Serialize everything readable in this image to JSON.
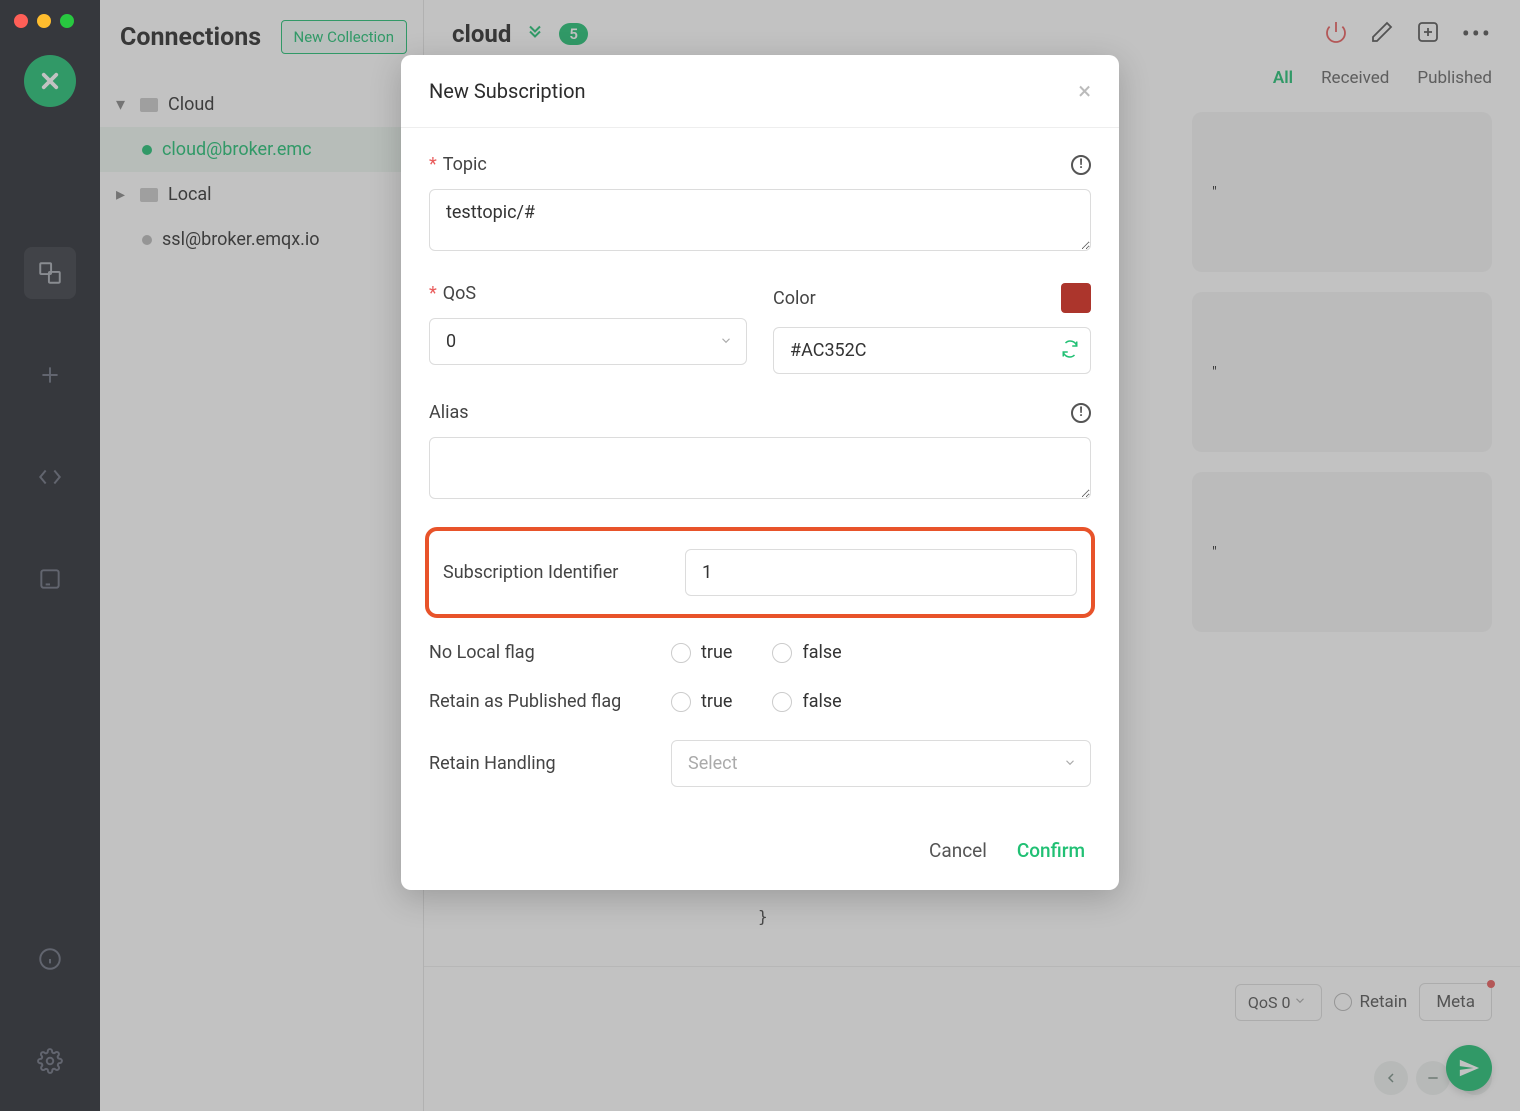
{
  "sidebar": {
    "title": "Connections",
    "new_collection_label": "New Collection",
    "tree": {
      "group1": {
        "label": "Cloud"
      },
      "item1": {
        "label": "cloud@broker.emc"
      },
      "group2": {
        "label": "Local"
      },
      "item2": {
        "label": "ssl@broker.emqx.io"
      }
    }
  },
  "header": {
    "title": "cloud",
    "badge": "5",
    "tabs": {
      "all": "All",
      "received": "Received",
      "published": "Published"
    }
  },
  "messages": {
    "card1": "\"",
    "card2": "\"",
    "card3": "\"",
    "json_close": "}"
  },
  "composer": {
    "qos_prefix": "QoS",
    "qos_value": "0",
    "retain_label": "Retain",
    "meta_label": "Meta"
  },
  "modal": {
    "title": "New Subscription",
    "topic": {
      "label": "Topic",
      "value": "testtopic/#"
    },
    "qos": {
      "label": "QoS",
      "value": "0"
    },
    "color": {
      "label": "Color",
      "value": "#AC352C",
      "swatch": "#AC352C"
    },
    "alias": {
      "label": "Alias",
      "value": ""
    },
    "sub_id": {
      "label": "Subscription Identifier",
      "value": "1"
    },
    "no_local": {
      "label": "No Local flag",
      "opt_true": "true",
      "opt_false": "false"
    },
    "retain_pub": {
      "label": "Retain as Published flag",
      "opt_true": "true",
      "opt_false": "false"
    },
    "retain_handling": {
      "label": "Retain Handling",
      "placeholder": "Select"
    },
    "cancel": "Cancel",
    "confirm": "Confirm"
  }
}
